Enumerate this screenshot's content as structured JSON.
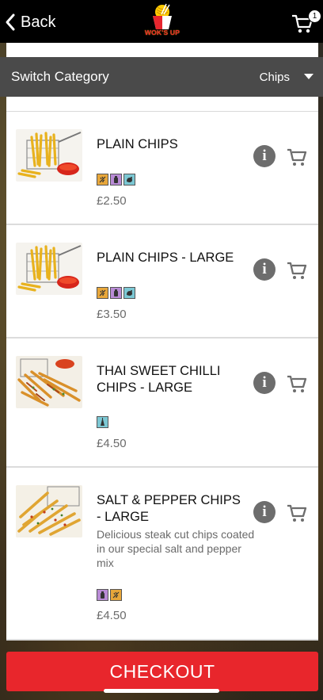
{
  "header": {
    "back_label": "Back",
    "logo_text": "WOK'S UP",
    "cart_count": "1"
  },
  "switch_bar": {
    "label": "Switch Category",
    "selected": "Chips"
  },
  "products": [
    {
      "name": "PLAIN CHIPS",
      "description": "",
      "price": "£2.50",
      "diet_icons": [
        "wheat-icon",
        "bottle-icon",
        "shellfish-icon"
      ],
      "image": "fries-in-basket-with-sauce"
    },
    {
      "name": "PLAIN CHIPS - LARGE",
      "description": "",
      "price": "£3.50",
      "diet_icons": [
        "wheat-icon",
        "bottle-icon",
        "shellfish-icon"
      ],
      "image": "fries-in-basket-with-sauce"
    },
    {
      "name": "THAI SWEET CHILLI CHIPS - LARGE",
      "description": "",
      "price": "£4.50",
      "diet_icons": [
        "celery-icon"
      ],
      "image": "sweet-chilli-fries"
    },
    {
      "name": "SALT & PEPPER CHIPS - LARGE",
      "description": "Delicious steak cut chips coated in our special salt and pepper mix",
      "price": "£4.50",
      "diet_icons": [
        "bottle-icon",
        "wheat-icon"
      ],
      "image": "salt-pepper-fries"
    }
  ],
  "checkout_label": "CHECKOUT",
  "colors": {
    "accent_red": "#e8262c",
    "header_black": "#000000",
    "switch_bar_gray": "#4a4a4a",
    "icon_gray": "#6d6d6d"
  }
}
